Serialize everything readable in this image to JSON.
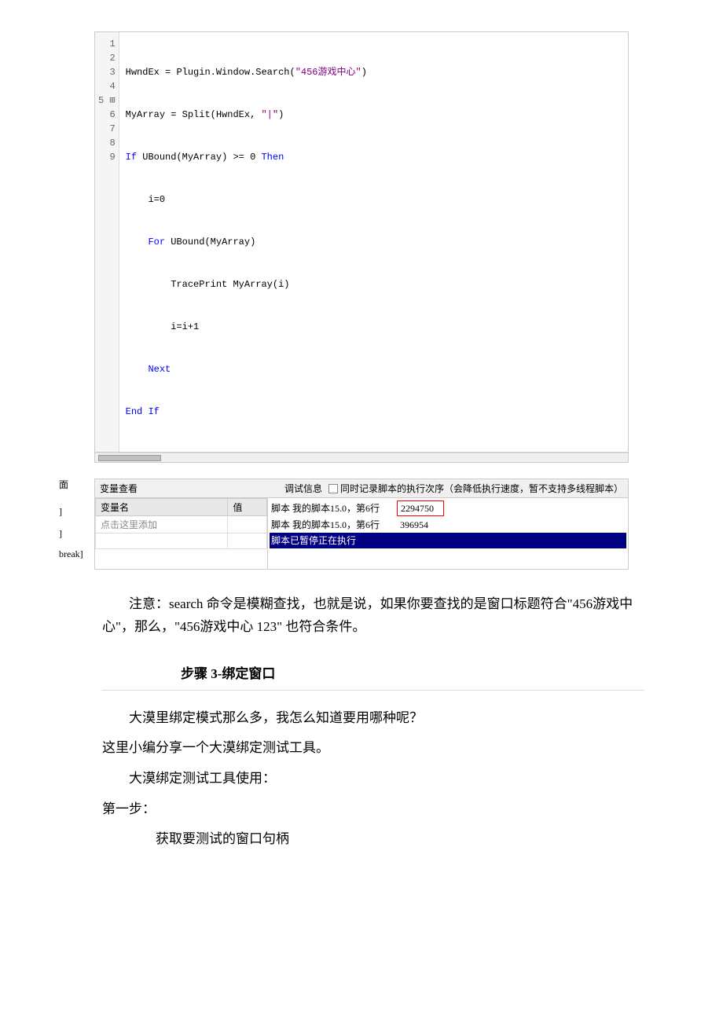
{
  "code": {
    "lines": [
      {
        "num": "1",
        "content": "HwndEx = Plugin.Window.Search(\"456游戏中心\")",
        "type": "normal"
      },
      {
        "num": "2",
        "content": "MyArray = Split(HwndEx, \"|\")",
        "type": "normal"
      },
      {
        "num": "3",
        "content": "If UBound(MyArray) >= 0 Then",
        "type": "keyword_if"
      },
      {
        "num": "4",
        "content": "    i=0",
        "type": "indent"
      },
      {
        "num": "5",
        "content": "    For UBound(MyArray)",
        "type": "for"
      },
      {
        "num": "6",
        "content": "        TracePrint MyArray(i)",
        "type": "indent2"
      },
      {
        "num": "7",
        "content": "        i=i+1",
        "type": "indent2"
      },
      {
        "num": "8",
        "content": "    Next",
        "type": "next"
      },
      {
        "num": "9",
        "content": "End If",
        "type": "endif"
      }
    ]
  },
  "debug_toolbar": {
    "label": "面",
    "var_label": "变量查看",
    "debug_info_label": "调试信息",
    "checkbox_label": "同时记录脚本的执行次序（会降低执行速度，暂不支持多线程脚本）"
  },
  "var_table": {
    "headers": [
      "变量名",
      "值"
    ],
    "rows": [
      {
        "name": "点击这里添加",
        "value": ""
      }
    ]
  },
  "debug_rows": [
    {
      "label": "脚本 我的脚本15.0，第6行",
      "value": "2294750",
      "highlight": false,
      "has_border": true
    },
    {
      "label": "脚本 我的脚本15.0，第6行",
      "value": "396954",
      "highlight": false,
      "has_border": false
    },
    {
      "label": "脚本已暂停正在执行",
      "value": "",
      "highlight": true,
      "has_border": false
    }
  ],
  "side_labels": [
    "面",
    "]",
    "]",
    "break]"
  ],
  "note": {
    "text": "注意：search 命令是模糊查找，也就是说，如果你要查找的是窗口标题符合\"456游戏中心\"，那么，\"456游戏中心 123\" 也符合条件。"
  },
  "step3": {
    "heading": "步骤 3-绑定窗口"
  },
  "body": {
    "line1": "大漠里绑定模式那么多，我怎么知道要用哪种呢？",
    "line2": "这里小编分享一个大漠绑定测试工具。",
    "line3": "大漠绑定测试工具使用：",
    "line4": "第一步：",
    "line5": "获取要测试的窗口句柄"
  }
}
